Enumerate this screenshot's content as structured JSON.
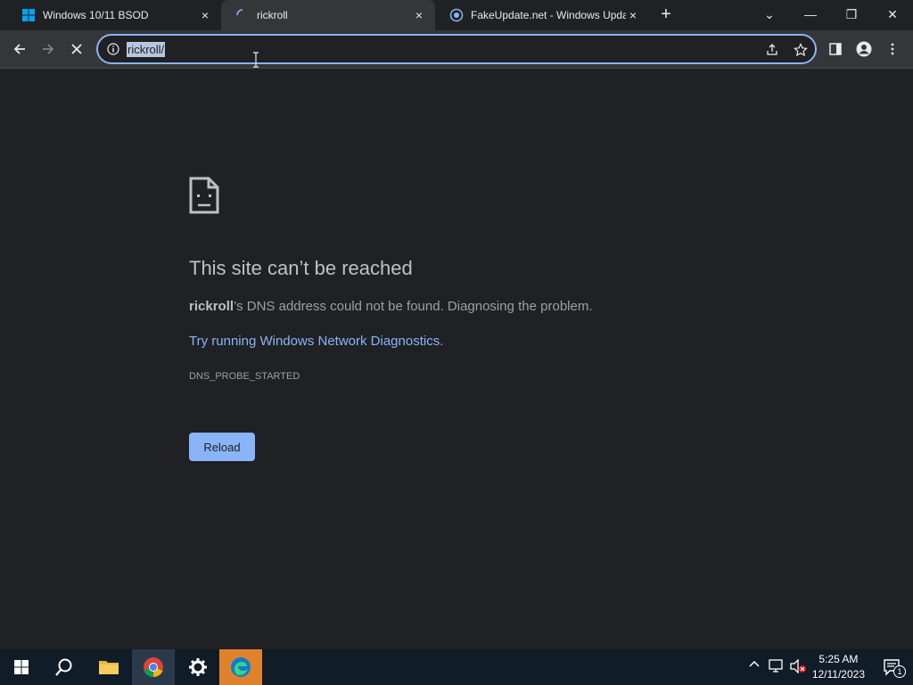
{
  "browser": {
    "tabs": [
      {
        "title": "Windows 10/11 BSOD",
        "close": "×"
      },
      {
        "title": "rickroll",
        "close": "×"
      },
      {
        "title": "FakeUpdate.net - Windows Upda",
        "close": "×"
      }
    ],
    "new_tab": "+",
    "window_controls": {
      "dropdown": "⌄",
      "minimize": "—",
      "restore": "❐",
      "close": "✕"
    },
    "url": "rickroll/"
  },
  "error_page": {
    "heading": "This site can’t be reached",
    "host": "rickroll",
    "description_rest": "’s DNS address could not be found. Diagnosing the problem.",
    "link_text": "Try running Windows Network Diagnostics",
    "link_suffix": ".",
    "error_code": "DNS_PROBE_STARTED",
    "reload_label": "Reload"
  },
  "taskbar": {
    "time": "5:25 AM",
    "date": "12/11/2023",
    "notification_count": "1"
  }
}
